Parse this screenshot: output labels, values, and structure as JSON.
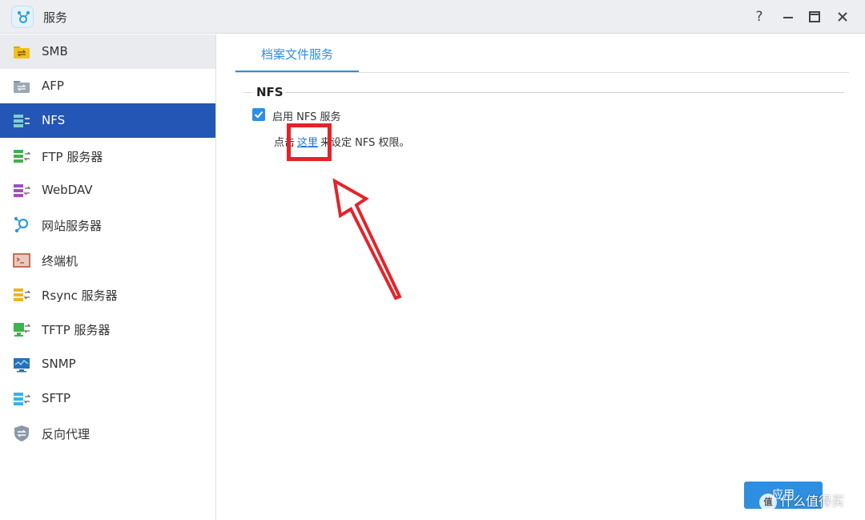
{
  "window": {
    "title": "服务",
    "help_glyph": "?"
  },
  "sidebar": {
    "items": [
      {
        "label": "SMB",
        "icon": "smb-icon"
      },
      {
        "label": "AFP",
        "icon": "afp-icon"
      },
      {
        "label": "NFS",
        "icon": "nfs-icon"
      },
      {
        "label": "FTP 服务器",
        "icon": "ftp-icon"
      },
      {
        "label": "WebDAV",
        "icon": "webdav-icon"
      },
      {
        "label": "网站服务器",
        "icon": "web-server-icon"
      },
      {
        "label": "终端机",
        "icon": "terminal-icon"
      },
      {
        "label": "Rsync 服务器",
        "icon": "rsync-icon"
      },
      {
        "label": "TFTP 服务器",
        "icon": "tftp-icon"
      },
      {
        "label": "SNMP",
        "icon": "snmp-icon"
      },
      {
        "label": "SFTP",
        "icon": "sftp-icon"
      },
      {
        "label": "反向代理",
        "icon": "reverse-proxy-icon"
      }
    ],
    "active_index": 2
  },
  "main": {
    "tab_label": "档案文件服务",
    "section_title": "NFS",
    "enable_label": "启用 NFS 服务",
    "enable_checked": true,
    "note_prefix": "点击",
    "note_link": "这里",
    "note_suffix": "来设定 NFS 权限。",
    "apply_label": "应用"
  },
  "watermark": {
    "text": "什么值得买",
    "badge": "值"
  },
  "colors": {
    "accent": "#2e8ee0",
    "sidebar_active": "#2456b5",
    "annotation_red": "#e4232a"
  }
}
